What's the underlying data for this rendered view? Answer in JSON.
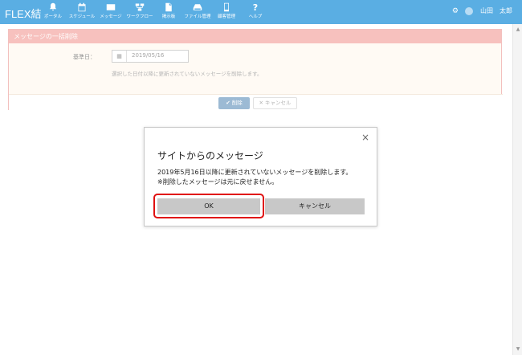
{
  "header": {
    "brand": "FLEX結",
    "nav": [
      {
        "label": "ポータル",
        "icon": "bell-icon"
      },
      {
        "label": "スケジュール",
        "icon": "calendar-icon"
      },
      {
        "label": "メッセージ",
        "icon": "mail-icon"
      },
      {
        "label": "ワークフロー",
        "icon": "flow-icon"
      },
      {
        "label": "掲示板",
        "icon": "document-icon"
      },
      {
        "label": "ファイル管理",
        "icon": "hdd-icon"
      },
      {
        "label": "顧客管理",
        "icon": "phone-icon"
      },
      {
        "label": "ヘルプ",
        "icon": "question-icon"
      }
    ],
    "user_name": "山田　太郎",
    "accent": "#5aaee3"
  },
  "panel": {
    "title": "メッセージの一括削除",
    "date_label": "基準日：",
    "date_value": "2019/05/16",
    "description": "選択した日付以降に更新されていないメッセージを削除します。",
    "delete_label": "削除",
    "cancel_label": "キャンセル"
  },
  "dialog": {
    "title": "サイトからのメッセージ",
    "message_line1": "2019年5月16日以降に更新されていないメッセージを削除します。",
    "message_line2": "※削除したメッセージは元に戻せません。",
    "ok_label": "OK",
    "cancel_label": "キャンセル",
    "highlight_color": "#e01010"
  }
}
